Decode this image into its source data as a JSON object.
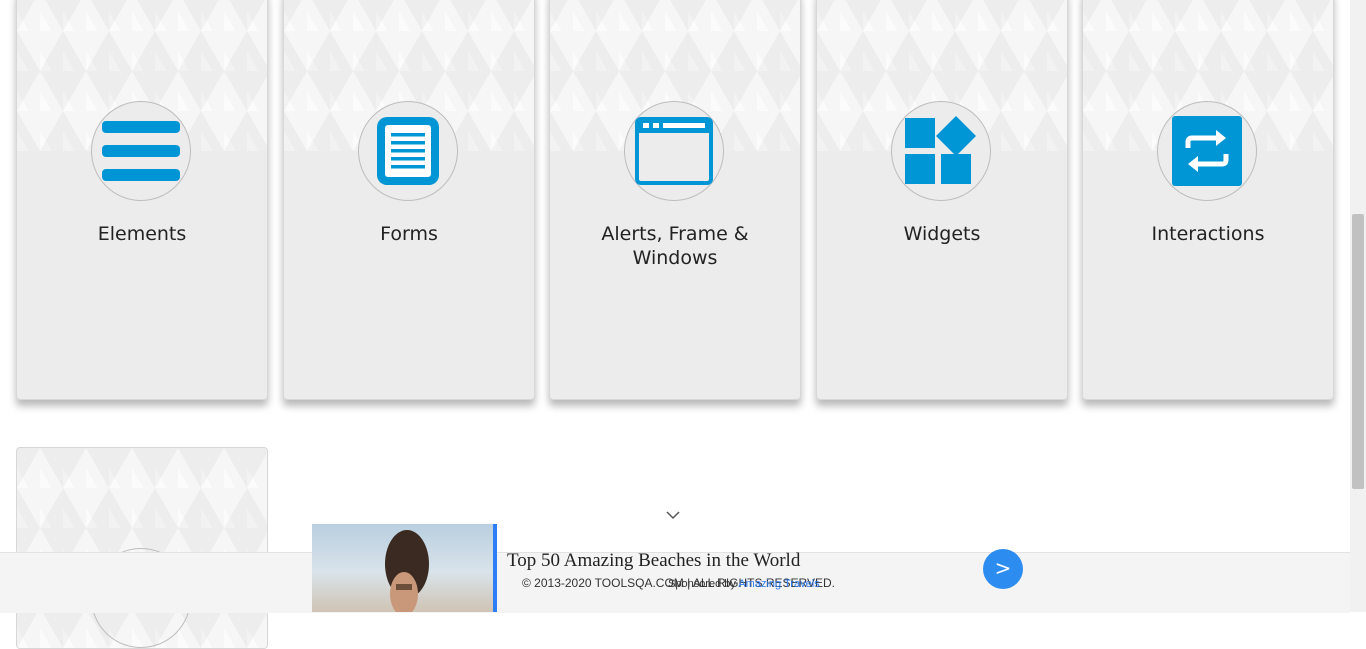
{
  "cards": [
    {
      "title": "Elements",
      "icon": "hamburger-icon"
    },
    {
      "title": "Forms",
      "icon": "document-icon"
    },
    {
      "title": "Alerts, Frame & Windows",
      "icon": "browser-window-icon"
    },
    {
      "title": "Widgets",
      "icon": "widgets-icon"
    },
    {
      "title": "Interactions",
      "icon": "swap-arrows-icon"
    }
  ],
  "accent_color": "#0096d6",
  "footer": {
    "copyright": "© 2013-2020 TOOLSQA.COM | ALL RIGHTS RESERVED."
  },
  "ad": {
    "title": "Top 50 Amazing Beaches in the World",
    "sponsored_prefix": "Sponsored by ",
    "sponsor": "Amazing Travels",
    "button_label": ">"
  }
}
